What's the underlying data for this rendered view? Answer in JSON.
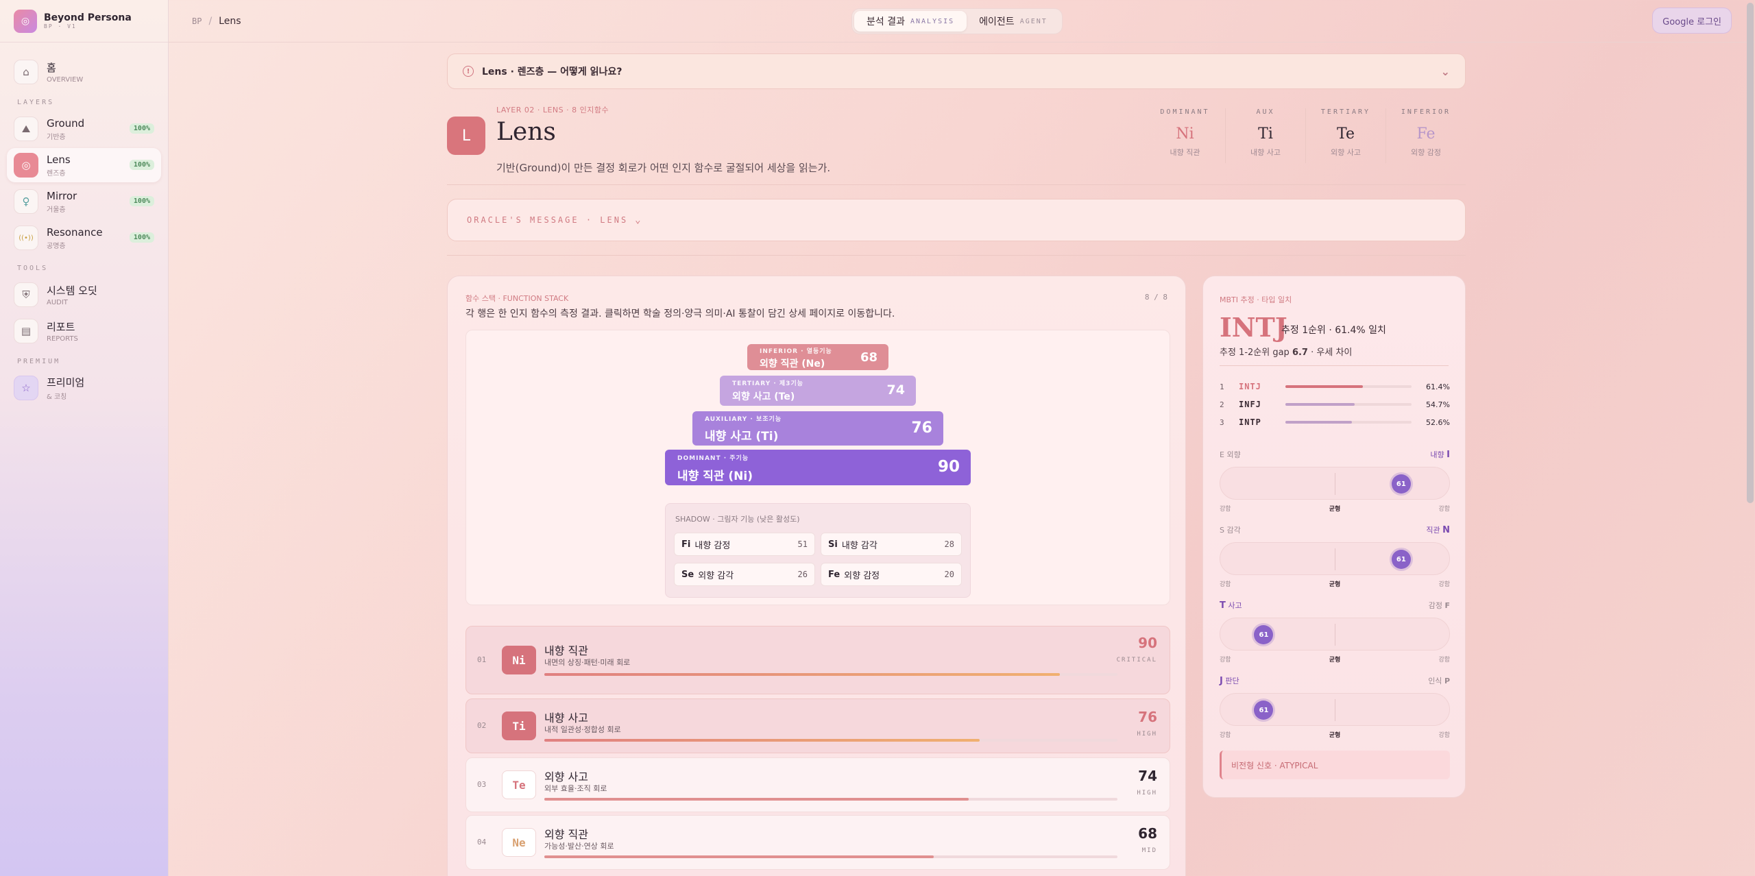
{
  "brand": {
    "name": "Beyond Persona",
    "sub": "BP · V1"
  },
  "nav": {
    "items": [
      {
        "title": "홈",
        "sub": "OVERVIEW",
        "icon": "home-icon",
        "glyph": "⌂"
      },
      {
        "title": "Ground",
        "sub": "기반층",
        "icon": "ground-icon",
        "glyph": "⛰",
        "badge": "100%"
      },
      {
        "title": "Lens",
        "sub": "렌즈층",
        "icon": "lens-icon",
        "glyph": "◎",
        "badge": "100%"
      },
      {
        "title": "Mirror",
        "sub": "거울층",
        "icon": "mirror-icon",
        "glyph": "♀",
        "badge": "100%"
      },
      {
        "title": "Resonance",
        "sub": "공명층",
        "icon": "resonance-icon",
        "glyph": "((•))",
        "badge": "100%"
      },
      {
        "title": "시스템 오딧",
        "sub": "AUDIT",
        "icon": "shield-icon",
        "glyph": "⛨"
      },
      {
        "title": "리포트",
        "sub": "REPORTS",
        "icon": "report-icon",
        "glyph": "▤"
      },
      {
        "title": "프리미엄",
        "sub": "& 코칭",
        "icon": "star-icon",
        "glyph": "☆"
      }
    ],
    "sections": {
      "layers": "LAYERS",
      "tools": "TOOLS",
      "premium": "PREMIUM"
    }
  },
  "topbar": {
    "crumb_root": "BP",
    "crumb_sep": "/",
    "crumb_page": "Lens",
    "tab_analysis": "분석 결과",
    "tab_analysis_en": "ANALYSIS",
    "tab_agent": "에이전트",
    "tab_agent_en": "AGENT",
    "login": "Google 로그인"
  },
  "banner": {
    "text": "Lens · 렌즈층 — 어떻게 읽나요?"
  },
  "header": {
    "icon_letter": "L",
    "eyebrow": "LAYER 02 · LENS · 8 인지함수",
    "title": "Lens",
    "desc": "기반(Ground)이 만든 결정 회로가 어떤 인지 함수로 굴절되어 세상을 읽는가.",
    "functions": [
      {
        "label": "DOMINANT",
        "code": "Ni",
        "sub": "내향 직관",
        "color": "#d6737c"
      },
      {
        "label": "AUX",
        "code": "Ti",
        "sub": "내향 사고",
        "color": "#2f2530"
      },
      {
        "label": "TERTIARY",
        "code": "Te",
        "sub": "외향 사고",
        "color": "#2f2530"
      },
      {
        "label": "INFERIOR",
        "code": "Fe",
        "sub": "외향 감정",
        "color": "#b796c9"
      }
    ]
  },
  "oracle": {
    "text": "ORACLE'S MESSAGE · LENS"
  },
  "stack": {
    "eyebrow": "함수 스택 · FUNCTION STACK",
    "count": "8 / 8",
    "desc": "각 행은 한 인지 함수의 측정 결과. 클릭하면 학술 정의·양극 의미·AI 통찰이 담긴 상세 페이지로 이동합니다.",
    "pyramid": [
      {
        "label": "INFERIOR · 열등기능",
        "name": "외향 직관 (Ne)",
        "value": 68
      },
      {
        "label": "TERTIARY · 제3기능",
        "name": "외향 사고 (Te)",
        "value": 74
      },
      {
        "label": "AUXILIARY · 보조기능",
        "name": "내향 사고 (Ti)",
        "value": 76
      },
      {
        "label": "DOMINANT · 주기능",
        "name": "내향 직관 (Ni)",
        "value": 90
      }
    ],
    "shadow_title": "SHADOW · 그림자 기능 (낮은 활성도)",
    "shadow": [
      {
        "code": "Fi",
        "name": "내향 감정",
        "value": "51"
      },
      {
        "code": "Si",
        "name": "내향 감각",
        "value": "28"
      },
      {
        "code": "Se",
        "name": "외향 감각",
        "value": "26"
      },
      {
        "code": "Fe",
        "name": "외향 감정",
        "value": "20"
      }
    ],
    "rows": [
      {
        "num": "01",
        "code": "Ni",
        "title": "내향 직관",
        "desc": "내면의 상징·패턴·미래 회로",
        "score": "90",
        "tier": "CRITICAL",
        "pct": 0.9
      },
      {
        "num": "02",
        "code": "Ti",
        "title": "내향 사고",
        "desc": "내적 일관성·정합성 회로",
        "score": "76",
        "tier": "HIGH",
        "pct": 0.76
      },
      {
        "num": "03",
        "code": "Te",
        "title": "외향 사고",
        "desc": "외부 효율·조직 회로",
        "score": "74",
        "tier": "HIGH",
        "pct": 0.74
      },
      {
        "num": "04",
        "code": "Ne",
        "title": "외향 직관",
        "desc": "가능성·발산·연상 회로",
        "score": "68",
        "tier": "MID",
        "pct": 0.68
      }
    ]
  },
  "mbti": {
    "eyebrow": "MBTI 추정 · 타입 일치",
    "type": "INTJ",
    "rank": "추정 1순위 · 61.4% 일치",
    "gap_prefix": "추정 1-2순위 gap",
    "gap_value": "6.7",
    "gap_suffix": "· 우세 차이",
    "candidates": [
      {
        "rank": "1",
        "type": "INTJ",
        "pct": "61.4%",
        "fill": 0.614
      },
      {
        "rank": "2",
        "type": "INFJ",
        "pct": "54.7%",
        "fill": 0.547
      },
      {
        "rank": "3",
        "type": "INTP",
        "pct": "52.6%",
        "fill": 0.526
      }
    ],
    "axes": [
      {
        "lcode": "E",
        "lname": "외향",
        "rname": "내향",
        "rcode": "I",
        "value": "61",
        "pos": 0.79,
        "left_hi": false
      },
      {
        "lcode": "S",
        "lname": "감각",
        "rname": "직관",
        "rcode": "N",
        "value": "61",
        "pos": 0.79,
        "left_hi": false
      },
      {
        "lcode": "T",
        "lname": "사고",
        "rname": "감정",
        "rcode": "F",
        "value": "61",
        "pos": 0.19,
        "left_hi": true
      },
      {
        "lcode": "J",
        "lname": "판단",
        "rname": "인식",
        "rcode": "P",
        "value": "61",
        "pos": 0.19,
        "left_hi": true
      }
    ],
    "scale": {
      "left": "강함",
      "center": "균형",
      "right": "강함"
    },
    "atypical": "비전형 신호 · ATYPICAL"
  }
}
